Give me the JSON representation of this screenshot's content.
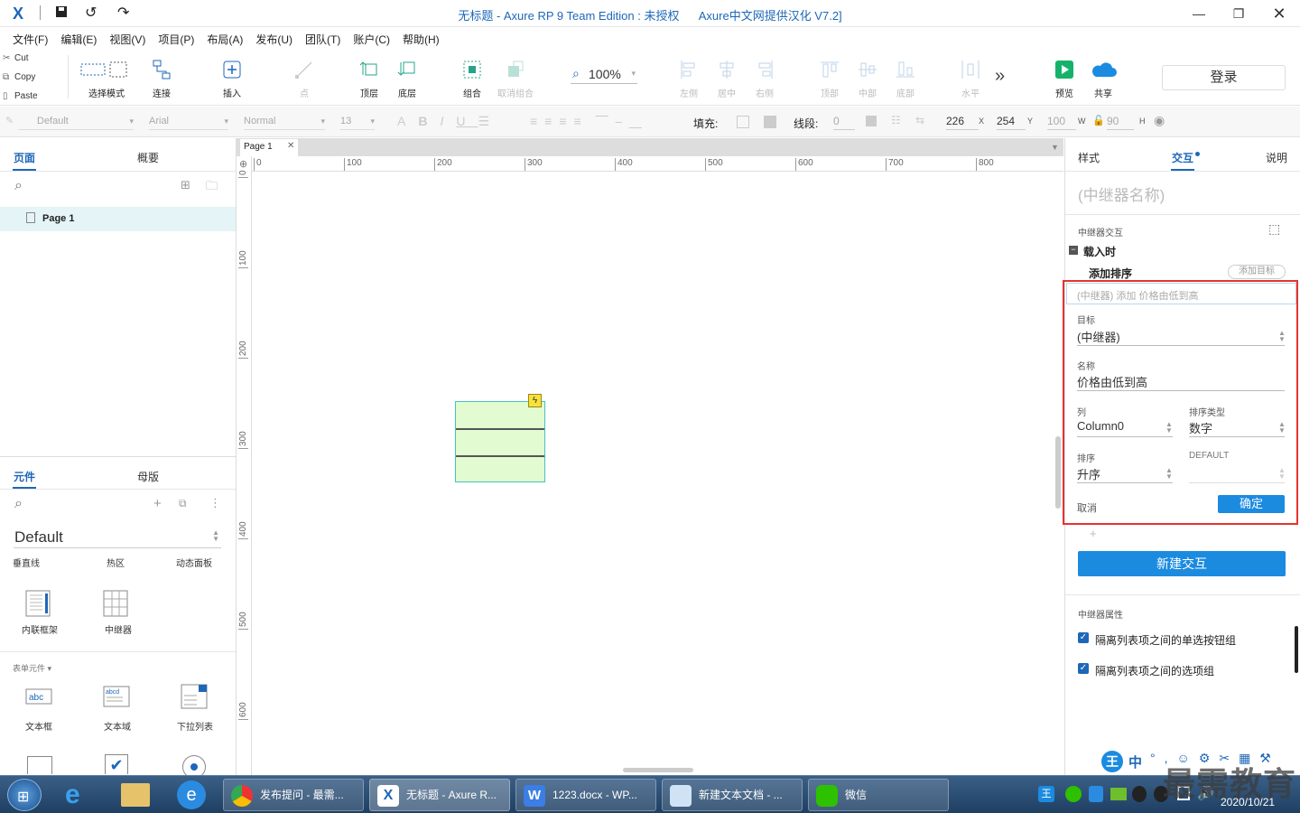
{
  "app": {
    "title_prefix": "无标题 - Axure RP 9 Team Edition : 未授权",
    "title_suffix": "Axure中文网提供汉化 V7.2]"
  },
  "menu": [
    "文件(F)",
    "编辑(E)",
    "视图(V)",
    "项目(P)",
    "布局(A)",
    "发布(U)",
    "团队(T)",
    "账户(C)",
    "帮助(H)"
  ],
  "clipboard": {
    "cut": "Cut",
    "copy": "Copy",
    "paste": "Paste"
  },
  "toolbar": {
    "select_mode": "选择模式",
    "connect": "连接",
    "insert": "插入",
    "point": "点",
    "top_layer": "顶层",
    "bottom_layer": "底层",
    "group": "组合",
    "ungroup": "取消组合",
    "zoom": "100%",
    "align_left": "左侧",
    "align_center": "居中",
    "align_right": "右侧",
    "align_top": "顶部",
    "align_middle": "中部",
    "align_bottom": "底部",
    "distribute_h": "水平",
    "more": "»",
    "preview": "预览",
    "share": "共享",
    "login": "登录"
  },
  "format": {
    "style": "Default",
    "font": "Arial",
    "weight": "Normal",
    "size": "13",
    "fill_label": "填充:",
    "stroke_label": "线段:",
    "stroke_value": "0",
    "x": "226",
    "x_label": "X",
    "y": "254",
    "y_label": "Y",
    "w": "100",
    "w_label": "W",
    "h": "90",
    "h_label": "H"
  },
  "left": {
    "tab_pages": "页面",
    "tab_outline": "概要",
    "page1": "Page 1",
    "tab_widgets": "元件",
    "tab_masters": "母版",
    "library": "Default",
    "widgets_row1": [
      "垂直线",
      "热区",
      "动态面板"
    ],
    "widgets_row2": [
      "内联框架",
      "中继器"
    ],
    "form_section": "表单元件 ▾",
    "widgets_row3": [
      "文本框",
      "文本域",
      "下拉列表"
    ]
  },
  "canvas": {
    "tab": "Page 1",
    "ruler_h": [
      "0",
      "100",
      "200",
      "300",
      "400",
      "500",
      "600",
      "700",
      "800"
    ],
    "ruler_v": [
      "0",
      "100",
      "200",
      "300",
      "400",
      "500",
      "600"
    ]
  },
  "right": {
    "tab_style": "样式",
    "tab_interaction": "交互",
    "tab_notes": "说明",
    "repeater_name_placeholder": "(中继器名称)",
    "repeater_interaction": "中继器交互",
    "on_load": "载入时",
    "add_sort": "添加排序",
    "add_target": "添加目标",
    "action_summary": "(中继器) 添加 价格由低到高",
    "target_label": "目标",
    "target_value": "(中继器)",
    "name_label": "名称",
    "name_value": "价格由低到高",
    "column_label": "列",
    "column_value": "Column0",
    "sort_type_label": "排序类型",
    "sort_type_value": "数字",
    "order_label": "排序",
    "order_value": "升序",
    "default_label": "DEFAULT",
    "cancel": "取消",
    "ok": "确定",
    "plus": "+",
    "new_interaction": "新建交互",
    "repeater_props": "中继器属性",
    "isolate_radio": "隔离列表项之间的单选按钮组",
    "isolate_group": "隔离列表项之间的选项组"
  },
  "taskbar": {
    "tasks": [
      "发布提问 - 最需...",
      "无标题 - Axure R...",
      "1223.docx - WP...",
      "新建文本文档 - ...",
      "微信"
    ],
    "tray_ime": "中",
    "date": "2020/10/21",
    "watermark": "最需教育"
  },
  "colors": {
    "accent": "#1d67b8",
    "highlight": "#e8322e",
    "primary_button": "#1b8be0"
  }
}
